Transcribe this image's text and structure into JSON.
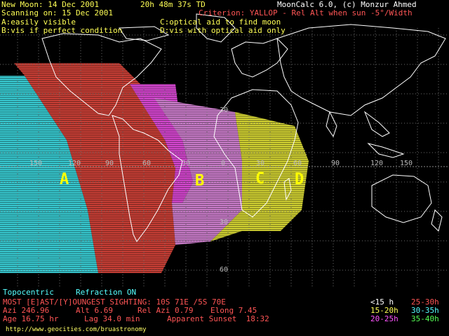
{
  "header": {
    "new_moon": "New Moon: 14 Dec 2001",
    "time": "20h 48m 37s TD",
    "app": "MoonCalc 6.0, (c) Monzur Ahmed",
    "scanning": "Scanning on: 15 Dec 2001",
    "criterion": "Criterion: YALLOP - Rel Alt when sun -5°/Width"
  },
  "legend_codes": {
    "a": "A:easily visible",
    "b": "B:vis if perfect condition",
    "c": "C:optical aid to find moon",
    "d": "D:vis with optical aid only"
  },
  "zones": [
    "A",
    "B",
    "C",
    "D"
  ],
  "grid_labels": {
    "lon": [
      "150",
      "120",
      "90",
      "60",
      "30",
      "0",
      "30",
      "60",
      "90",
      "120",
      "150"
    ],
    "lat_30n": "30",
    "lat_30s": "30",
    "lat_60s": "60"
  },
  "footer": {
    "topo": "Topocentric",
    "refraction": "Refraction ON",
    "most": "MOST [E]AST/[Y]OUNGEST SIGHTING: 10S 71E /5S 70E",
    "azi": "Azi 246.96",
    "alt": "Alt 6.69",
    "relazi": "Rel Azi 0.79",
    "elong": "Elong 7.45",
    "age": "Age 16.75 hr",
    "lag": "Lag 34.0 min",
    "sunset": "Apparent Sunset  18:32",
    "url": "http://www.geocities.com/bruastronomy"
  },
  "age_legend": [
    {
      "label": "<15 h",
      "color": "#ffffff"
    },
    {
      "label": "25-30h",
      "color": "#ff5555"
    },
    {
      "label": "15-20h",
      "color": "#ffff55"
    },
    {
      "label": "30-35h",
      "color": "#55ffff"
    },
    {
      "label": "20-25h",
      "color": "#ff55ff"
    },
    {
      "label": "35-40h",
      "color": "#55ff55"
    }
  ],
  "colors": {
    "header": "#ffffff",
    "accent_yellow": "#ffff00",
    "topo": "#55ffff",
    "footer_red": "#ff5555",
    "cyan_zone": "#3ee0e8",
    "red_zone": "#e0463c",
    "magenta_zone": "#ee4ee8",
    "pink_zone": "#e08ae0",
    "yellow_zone": "#e8e838",
    "url_yellow": "#ffff66"
  }
}
